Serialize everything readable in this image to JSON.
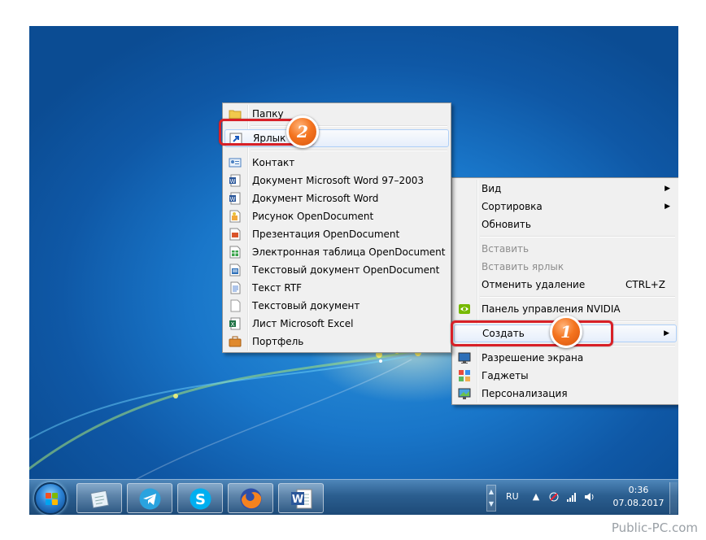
{
  "context_menu": {
    "items": [
      {
        "label": "Вид",
        "submenu": true
      },
      {
        "label": "Сортировка",
        "submenu": true
      },
      {
        "label": "Обновить"
      },
      {
        "label": "Вставить",
        "disabled": true
      },
      {
        "label": "Вставить ярлык",
        "disabled": true
      },
      {
        "label": "Отменить удаление",
        "shortcut": "CTRL+Z"
      },
      {
        "label": "Панель управления NVIDIA",
        "icon": "nvidia-icon"
      },
      {
        "label": "Создать",
        "submenu": true,
        "highlighted": true
      },
      {
        "label": "Разрешение экрана",
        "icon": "display-icon"
      },
      {
        "label": "Гаджеты",
        "icon": "gadgets-icon"
      },
      {
        "label": "Персонализация",
        "icon": "personalize-icon"
      }
    ]
  },
  "create_submenu": {
    "items": [
      {
        "label": "Папку",
        "icon": "folder-icon"
      },
      {
        "label": "Ярлык",
        "icon": "shortcut-icon",
        "highlighted": true
      },
      {
        "label": "Контакт",
        "icon": "contact-icon"
      },
      {
        "label": "Документ Microsoft Word 97–2003",
        "icon": "word-doc-icon"
      },
      {
        "label": "Документ Microsoft Word",
        "icon": "word-docx-icon"
      },
      {
        "label": "Рисунок OpenDocument",
        "icon": "odg-icon"
      },
      {
        "label": "Презентация OpenDocument",
        "icon": "odp-icon"
      },
      {
        "label": "Электронная таблица OpenDocument",
        "icon": "ods-icon"
      },
      {
        "label": "Текстовый документ OpenDocument",
        "icon": "odt-icon"
      },
      {
        "label": "Текст RTF",
        "icon": "rtf-icon"
      },
      {
        "label": "Текстовый документ",
        "icon": "txt-icon"
      },
      {
        "label": "Лист Microsoft Excel",
        "icon": "excel-icon"
      },
      {
        "label": "Портфель",
        "icon": "briefcase-icon"
      }
    ]
  },
  "annotations": {
    "step1": "1",
    "step2": "2"
  },
  "taskbar": {
    "pinned": [
      "notes-icon",
      "telegram-icon",
      "skype-icon",
      "firefox-icon",
      "word-icon"
    ],
    "language": "RU",
    "time": "0:36",
    "date": "07.08.2017"
  },
  "watermark": "Public-PC.com",
  "colors": {
    "accent_red": "#d82027",
    "badge_orange": "#f4741f",
    "desktop_blue": "#1976c9"
  }
}
